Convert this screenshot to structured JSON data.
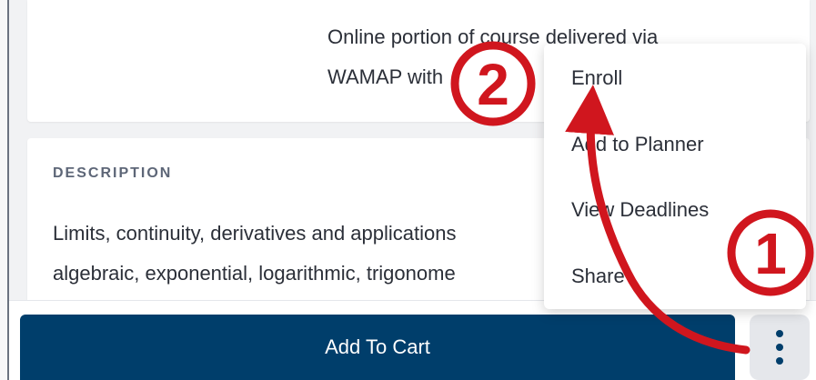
{
  "course_card": {
    "delivery_line_1": "Online portion of course delivered via",
    "delivery_line_2": "WAMAP with"
  },
  "description": {
    "heading": "DESCRIPTION",
    "line_1": "Limits, continuity, derivatives and applications",
    "line_2": "algebraic, exponential, logarithmic, trigonome"
  },
  "actions": {
    "add_to_cart_label": "Add To Cart",
    "more_icon": "kebab-vertical-icon"
  },
  "menu": {
    "items": [
      {
        "label": "Enroll"
      },
      {
        "label": "Add to Planner"
      },
      {
        "label": "View Deadlines"
      },
      {
        "label": "Share"
      }
    ]
  },
  "annotations": {
    "step_one": "1",
    "step_two": "2",
    "color": "#d0161e"
  }
}
